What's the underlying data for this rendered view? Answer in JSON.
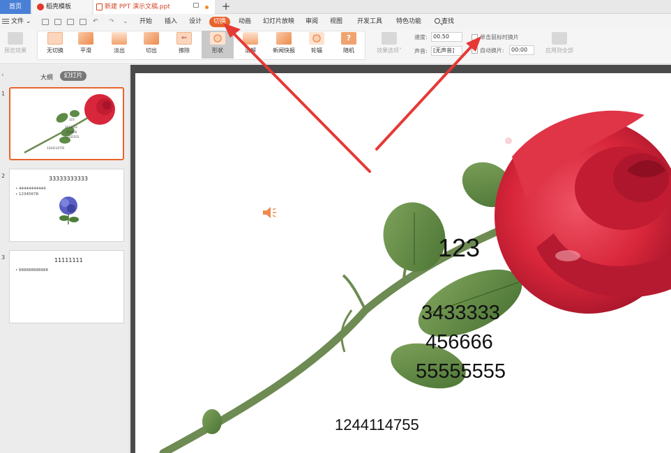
{
  "tabs": {
    "home": "首页",
    "template": "稻壳模板",
    "document": "新建 PPT 演示文稿.ppt",
    "add": "+"
  },
  "menu": {
    "file": "文件",
    "items": [
      "开始",
      "插入",
      "设计",
      "切换",
      "动画",
      "幻灯片放映",
      "审阅",
      "视图",
      "开发工具",
      "特色功能"
    ],
    "active": "切换",
    "search": "查找"
  },
  "ribbon": {
    "preview": "预览效果",
    "transitions": [
      "无切换",
      "平滑",
      "淡出",
      "切出",
      "擦除",
      "形状",
      "溶解",
      "新闻快报",
      "轮辐",
      "随机"
    ],
    "selected_transition": "形状",
    "effect_options": "效果选项",
    "speed_label": "速度:",
    "speed_value": "00.50",
    "sound_label": "声音:",
    "sound_value": "[无声音]",
    "on_click_label": "单击鼠标时换片",
    "auto_label": "自动换片:",
    "auto_value": "00:00",
    "apply_all": "应用到全部"
  },
  "left_panel": {
    "view_outline": "大纲",
    "view_slides": "幻灯片",
    "thumbs": [
      {
        "num": "1",
        "lines": [
          "123",
          "3433333",
          "456666",
          "55555555",
          "1244114755"
        ]
      },
      {
        "num": "2",
        "title": "33333333333",
        "bullets": [
          "44444444444",
          "12345678"
        ]
      },
      {
        "num": "3",
        "title": "11111111",
        "bullets": [
          "888888888888"
        ]
      }
    ]
  },
  "slide": {
    "line1": "123",
    "line2": "3433333",
    "line3": "456666",
    "line4": "55555555",
    "footer": "1244114755"
  },
  "colors": {
    "accent": "#e9632c",
    "home_tab": "#4a7fd6",
    "annotation_arrow": "#e53935",
    "rose": "#d8263a",
    "leaf": "#5e8b46"
  }
}
